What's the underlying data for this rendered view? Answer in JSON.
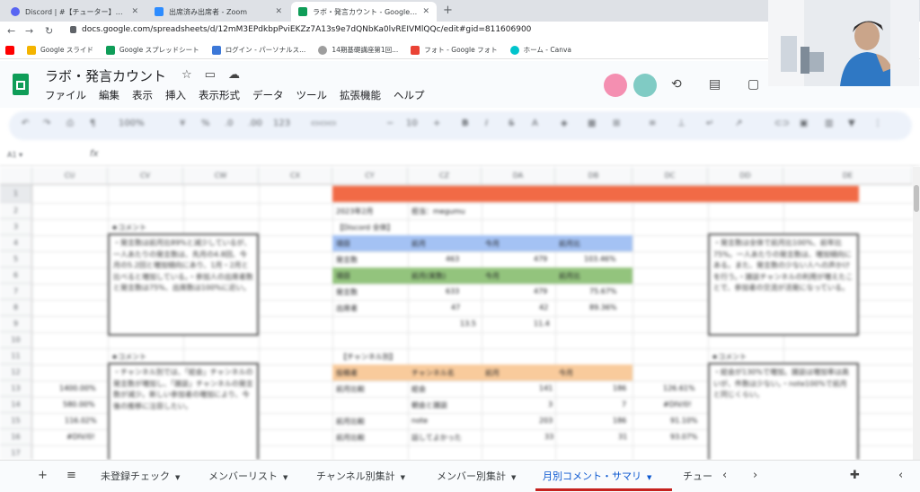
{
  "browser": {
    "tabs": [
      {
        "title": "Discord | #【チューター】運営mtg | ホ",
        "active": false,
        "color": "#5865f2"
      },
      {
        "title": "出席済み出席者 - Zoom",
        "active": false,
        "color": "#2d8cff"
      },
      {
        "title": "ラボ・発言カウント - Google スプレッ",
        "active": true,
        "color": "#0f9d58"
      }
    ],
    "new_tab": "+",
    "url": "docs.google.com/spreadsheets/d/12mM3EPdkbpPviEKZz7A13s9e7dQNbKa0lvREIVMlQQc/edit#gid=811606900",
    "bookmarks": [
      {
        "label": "",
        "color": "#ff0000"
      },
      {
        "label": "Google スライド",
        "color": "#f4b400"
      },
      {
        "label": "Google スプレッドシート",
        "color": "#0f9d58"
      },
      {
        "label": "ログイン - パーソナルス...",
        "color": "#3c78d8"
      },
      {
        "label": "14期基礎講座第1回...",
        "color": "#9e9e9e"
      },
      {
        "label": "フォト - Google フォト",
        "color": "#ea4335"
      },
      {
        "label": "ホーム - Canva",
        "color": "#00c4cc"
      }
    ]
  },
  "sheets": {
    "title": "ラボ・発言カウント",
    "menu": [
      "ファイル",
      "編集",
      "表示",
      "挿入",
      "表示形式",
      "データ",
      "ツール",
      "拡張機能",
      "ヘルプ"
    ],
    "toolbar": {
      "zoom": "100%",
      "font_size": "10"
    },
    "columns": [
      "CU",
      "CV",
      "CW",
      "CX",
      "CY",
      "CZ",
      "DA",
      "DB",
      "DC",
      "DD",
      "DE"
    ],
    "rows": [
      "1",
      "2",
      "3",
      "4",
      "5",
      "6",
      "7",
      "8",
      "9",
      "10",
      "11",
      "12",
      "13",
      "14",
      "15",
      "16",
      "17"
    ],
    "content": {
      "month": "2023年2月",
      "user": "担当：megumu",
      "section1": "【Discord 全体】",
      "hdr1": [
        "項目",
        "前月",
        "今月",
        "前月比"
      ],
      "row1": [
        "発言数",
        "463",
        "479",
        "103.46%"
      ],
      "hdr2": [
        "項目",
        "前月(実数)",
        "今月",
        "前月比"
      ],
      "row2": [
        "発言数",
        "633",
        "479",
        "75.67%"
      ],
      "row3": [
        "出席者",
        "47",
        "42",
        "89.36%"
      ],
      "row4": [
        "",
        "13.5",
        "11.4",
        ""
      ],
      "section2": "【チャンネル別】",
      "hdr3": [
        "投稿者",
        "チャンネル名",
        "前月",
        "今月"
      ],
      "row5": [
        "前月比較",
        "総会",
        "141",
        "186",
        "126.61%"
      ],
      "row6": [
        "",
        "朝会と雑談",
        "3",
        "7",
        "#DIV/0!"
      ],
      "row7": [
        "前月比較",
        "note",
        "203",
        "186",
        "91.10%"
      ],
      "row8": [
        "前月比較",
        "話してよかった",
        "33",
        "31",
        "93.07%"
      ],
      "left_values": [
        "1400.00%",
        "580.00%",
        "116.02%",
        "#DIV/0!"
      ],
      "comment_label": "★コメント",
      "comment1": "・発言数は前月比89%と減少しているが、一人あたりの発言数は、先月の4.8回、今月の5.2回と増加傾向にあり、1月・2月と比べると増加している。・参加人の出席者数と発言数は75%、出席数は100%に近い。",
      "comment2": "・発言数は全体で前月比100%、前年比75%。一人あたりの発言数は、増加傾向にある。また、発言数の少ない人への声かけを行う。・雑談チャンネルの利用が増えたことで、参加者の交流が活発になっている。",
      "comment3": "・チャンネル別では、「総会」チャンネルの発言数が増加し、「雑談」チャンネルの発言数が減少。新しい参加者の増加により、今後の推移に注目したい。",
      "comment4": "・総会が130%で増加。雑談は増加率は高いが、件数は少ない。・note100%で前月と同じくらい。"
    },
    "sheet_tabs": [
      "未登録チェック",
      "メンバーリスト",
      "チャンネル別集計",
      "メンバー別集計",
      "月別コメント・サマリ",
      "チュー"
    ],
    "active_sheet": "月別コメント・サマリ",
    "colors": {
      "red_band": "#f16a46",
      "blue": "#a4c2f4",
      "green": "#93c47d",
      "orange": "#f9cb9c",
      "active_tab": "#0b57d0"
    }
  }
}
